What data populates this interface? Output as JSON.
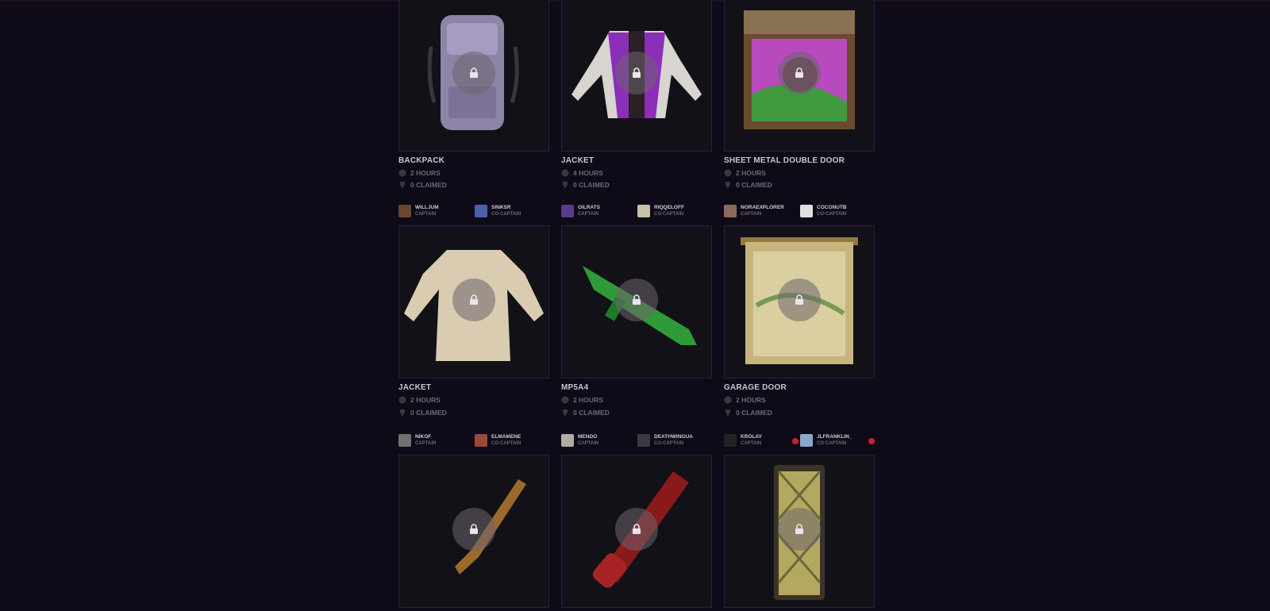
{
  "rewards": [
    {
      "title": "BACKPACK",
      "hours": "2 HOURS",
      "claimed": "0 CLAIMED",
      "icon": "backpack-icon",
      "lock": "lock-icon"
    },
    {
      "title": "JACKET",
      "hours": "4 HOURS",
      "claimed": "0 CLAIMED",
      "icon": "jacket-icon",
      "lock": "lock-icon"
    },
    {
      "title": "SHEET METAL DOUBLE DOOR",
      "hours": "2 HOURS",
      "claimed": "0 CLAIMED",
      "icon": "door-icon",
      "lock": "lock-icon"
    },
    {
      "title": "JACKET",
      "hours": "2 HOURS",
      "claimed": "0 CLAIMED",
      "icon": "fur-jacket-icon",
      "lock": "lock-icon"
    },
    {
      "title": "MP5A4",
      "hours": "2 HOURS",
      "claimed": "0 CLAIMED",
      "icon": "smg-icon",
      "lock": "lock-icon"
    },
    {
      "title": "GARAGE DOOR",
      "hours": "2 HOURS",
      "claimed": "0 CLAIMED",
      "icon": "garage-door-icon",
      "lock": "lock-icon"
    },
    {
      "icon": "rocket-launcher-icon",
      "lock": "lock-icon"
    },
    {
      "icon": "rocket-tube-icon",
      "lock": "lock-icon"
    },
    {
      "icon": "metal-door-icon",
      "lock": "lock-icon"
    }
  ],
  "teams": [
    {
      "captain": "WILLJUM",
      "captain_role": "CAPTAIN",
      "co": "SINKSR",
      "co_role": "CO-CAPTAIN"
    },
    {
      "captain": "OILRATS",
      "captain_role": "CAPTAIN",
      "co": "RIQQELOFF",
      "co_role": "CO-CAPTAIN"
    },
    {
      "captain": "NORAEXPLORER",
      "captain_role": "CAPTAIN",
      "co": "COCONUTB",
      "co_role": "CO-CAPTAIN"
    },
    {
      "captain": "NIKOF",
      "captain_role": "CAPTAIN",
      "co": "ELMAMENE",
      "co_role": "CO-CAPTAIN"
    },
    {
      "captain": "MENDO",
      "captain_role": "CAPTAIN",
      "co": "DEATHWINGUA",
      "co_role": "CO-CAPTAIN"
    },
    {
      "captain": "KROLAY",
      "captain_role": "CAPTAIN",
      "co": "JLFRANKLIN_",
      "co_role": "CO-CAPTAIN",
      "live": true
    }
  ],
  "colors": {
    "background": "#0f0a17",
    "card": "#131118",
    "card_border": "#2a1f45",
    "live": "#c3242c"
  }
}
